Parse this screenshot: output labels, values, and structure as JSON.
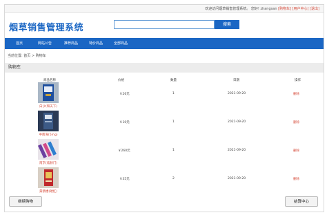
{
  "topbar": {
    "welcome": "欢迎访问烟草销售管理系统。 您好! zhangsan",
    "cart_link": "[购物车]",
    "user_center_link": "[用户中心]",
    "logout_link": "[退出]"
  },
  "header": {
    "logo": "烟草销售管理系统",
    "search_button": "搜索"
  },
  "nav": [
    "首页",
    "网站公告",
    "推荐商品",
    "特价商品",
    "全部商品"
  ],
  "breadcrumb": "当前位置: 首页 > 购物车",
  "panel_title": "购物车",
  "table": {
    "headers": [
      "商品名称",
      "价格",
      "数量",
      "日期",
      "操作"
    ],
    "rows": [
      {
        "name": "白沙(和天下)",
        "price": "￥26元",
        "qty": "1",
        "date": "2021-09-20",
        "action": "删除"
      },
      {
        "name": "中南海(5mg)",
        "price": "￥10元",
        "qty": "1",
        "date": "2021-09-20",
        "action": "删除"
      },
      {
        "name": "南京(炫赫门)",
        "price": "￥260元",
        "qty": "1",
        "date": "2021-09-20",
        "action": "删除"
      },
      {
        "name": "黄鹤楼(硬红)",
        "price": "￥35元",
        "qty": "2",
        "date": "2021-09-20",
        "action": "删除"
      }
    ]
  },
  "buttons": {
    "continue": "继续购物",
    "checkout": "结算中心"
  },
  "colors": {
    "brand": "#1a66c4",
    "link_red": "#d64b3a"
  }
}
